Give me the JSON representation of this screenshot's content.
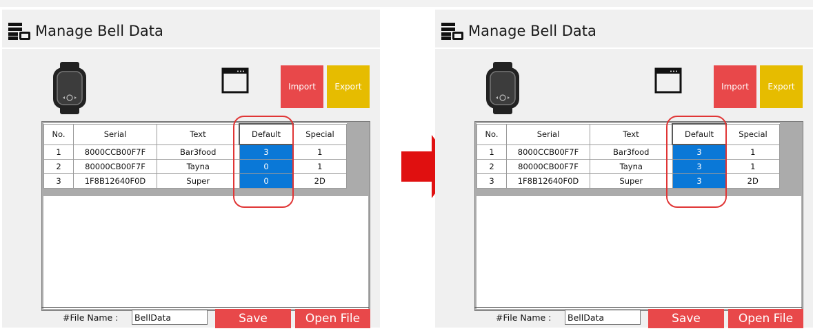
{
  "title": "Manage Bell Data",
  "colors": {
    "import_button": "#e8484a",
    "export_button": "#e6bc00",
    "save_button": "#e8484a",
    "open_file_button": "#e8484a",
    "selected_cell": "#0a78d7",
    "highlight_outline": "#e03535",
    "arrow": "#e01010"
  },
  "icons": {
    "header": "database-icon",
    "device": "smartwatch-icon",
    "window": "window-icon",
    "transition": "right-arrow-icon"
  },
  "buttons": {
    "import": "Import",
    "export": "Export",
    "save": "Save",
    "open_file": "Open File"
  },
  "file_name": {
    "label": "#File Name :",
    "value": "BellData"
  },
  "columns": [
    "No.",
    "Serial",
    "Text",
    "Default",
    "Special"
  ],
  "before": {
    "rows": [
      {
        "no": "1",
        "serial": "8000CCB00F7F",
        "text": "Bar3food",
        "default": "3",
        "special": "1"
      },
      {
        "no": "2",
        "serial": "80000CB00F7F",
        "text": "Tayna",
        "default": "0",
        "special": "1"
      },
      {
        "no": "3",
        "serial": "1F8B12640F0D",
        "text": "Super",
        "default": "0",
        "special": "2D"
      }
    ]
  },
  "after": {
    "rows": [
      {
        "no": "1",
        "serial": "8000CCB00F7F",
        "text": "Bar3food",
        "default": "3",
        "special": "1"
      },
      {
        "no": "2",
        "serial": "80000CB00F7F",
        "text": "Tayna",
        "default": "3",
        "special": "1"
      },
      {
        "no": "3",
        "serial": "1F8B12640F0D",
        "text": "Super",
        "default": "3",
        "special": "2D"
      }
    ]
  }
}
